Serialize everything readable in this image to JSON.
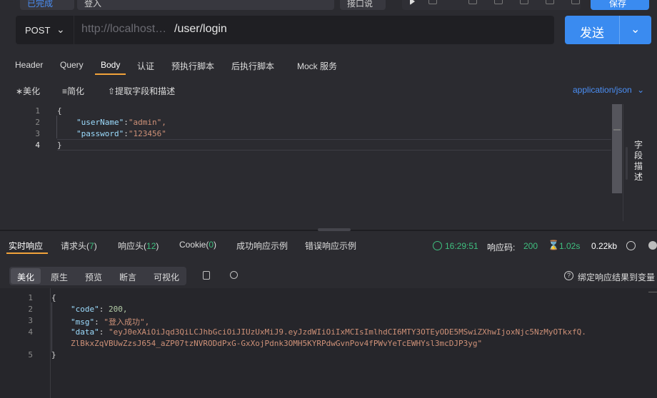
{
  "top": {
    "status_pill": "已完成",
    "api_name": "登入",
    "api_doc": "接口说明",
    "save_label": "保存"
  },
  "request": {
    "method": "POST",
    "url_host": "http://localhost…",
    "url_path": "/user/login",
    "send_label": "发送"
  },
  "req_tabs": [
    "Header",
    "Query",
    "Body",
    "认证",
    "预执行脚本",
    "后执行脚本",
    "Mock 服务"
  ],
  "body_tools": {
    "beautify": "美化",
    "simplify": "简化",
    "extract": "提取字段和描述",
    "content_type": "application/json"
  },
  "req_editor": {
    "line_numbers": [
      "1",
      "2",
      "3",
      "4"
    ],
    "lines": [
      {
        "t": "{"
      },
      {
        "k": "\"userName\"",
        "v": "\"admin\","
      },
      {
        "k": "\"password\"",
        "v": "\"123456\""
      },
      {
        "t": "}"
      }
    ]
  },
  "side_panel": {
    "label": "字段描述"
  },
  "res_tabs": {
    "realtime": "实时响应",
    "req_headers": "请求头",
    "req_headers_count": "7",
    "res_headers": "响应头",
    "res_headers_count": "12",
    "cookie": "Cookie",
    "cookie_count": "0",
    "success_example": "成功响应示例",
    "error_example": "错误响应示例"
  },
  "res_meta": {
    "time": "16:29:51",
    "code_label": "响应码:",
    "code": "200",
    "duration": "1.02s",
    "size": "0.22kb"
  },
  "view_modes": [
    "美化",
    "原生",
    "预览",
    "断言",
    "可视化"
  ],
  "bind_text": "绑定响应结果到变量",
  "res_editor": {
    "line_numbers": [
      "1",
      "2",
      "3",
      "4",
      "5"
    ],
    "open": "{",
    "code_key": "\"code\"",
    "code_val": "200,",
    "msg_key": "\"msg\"",
    "msg_val": "\"登入成功\",",
    "data_key": "\"data\"",
    "data_val_1": "\"eyJ0eXAiOiJqd3QiLCJhbGciOiJIUzUxMiJ9.eyJzdWIiOiIxMCIsImlhdCI6MTY3OTEyODE5MSwiZXhwIjoxNjc5NzMyOTkxfQ.",
    "data_val_2": "ZlBkxZqVBUwZzsJ654_aZP07tzNVRODdPxG-GxXojPdnk3OMH5KYRPdwGvnPov4fPWvYeTcEWHYsl3mcDJP3yg\"",
    "close": "}"
  },
  "colors": {
    "accent_orange": "#f2a33a",
    "send_blue": "#3a8bf0",
    "success_green": "#3fbf7f",
    "json_key": "#9cdcfe",
    "json_string": "#ce9178",
    "json_number": "#b5cea8"
  }
}
